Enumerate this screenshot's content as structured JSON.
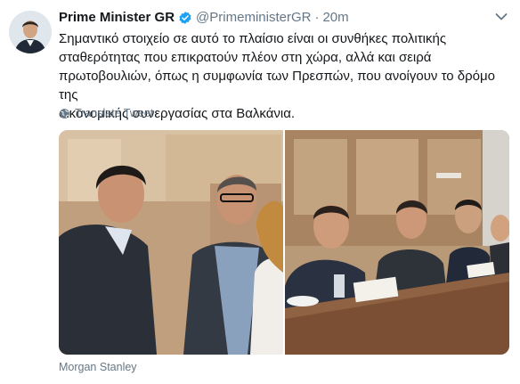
{
  "tweet": {
    "author_name": "Prime Minister GR",
    "handle": "@PrimeministerGR",
    "separator": "·",
    "time": "20m",
    "lines": [
      "Σημαντικό στοιχείο σε αυτό το πλαίσιο είναι οι συνθήκες πολιτικής",
      "σταθερότητας που επικρατούν πλέον στη χώρα, αλλά και σειρά",
      "πρωτοβουλιών, όπως η συμφωνία των Πρεσπών, που ανοίγουν το δρόμο της",
      "οικονομικής συνεργασίας στα Βαλκάνια."
    ],
    "translate_label": "Translate Tweet",
    "media_caption": "Morgan Stanley"
  },
  "colors": {
    "verified": "#1da1f2",
    "secondary_text": "#657786",
    "primary_text": "#14171a"
  },
  "icons": [
    "verified-badge-icon",
    "chevron-down-icon",
    "globe-icon"
  ]
}
